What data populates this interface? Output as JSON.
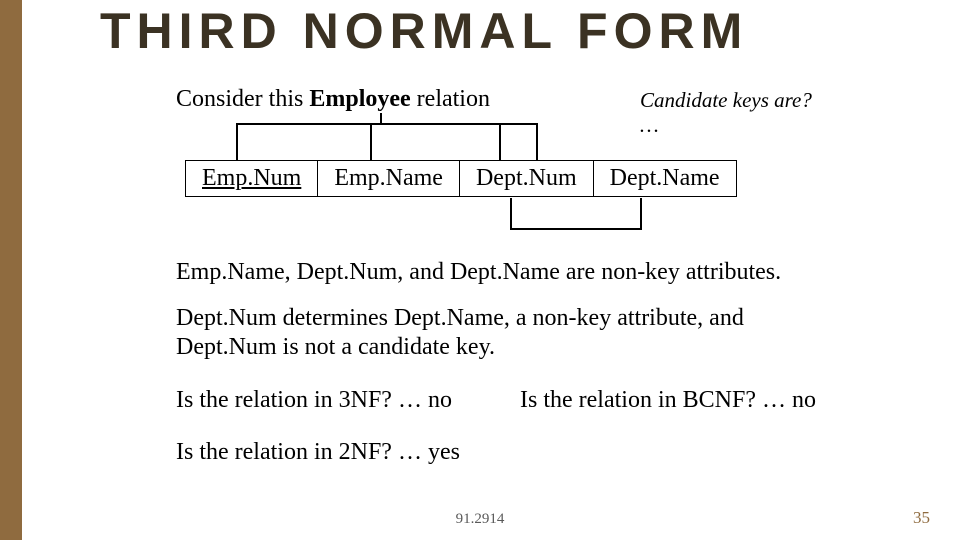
{
  "title": "THIRD NORMAL FORM",
  "intro_prefix": "Consider this ",
  "intro_bold": "Employee",
  "intro_suffix": " relation",
  "candidate_note": "Candidate keys are? …",
  "columns": [
    "Emp.Num",
    "Emp.Name",
    "Dept.Num",
    "Dept.Name"
  ],
  "para1": "Emp.Name, Dept.Num, and Dept.Name are non-key attributes.",
  "para2": "Dept.Num determines Dept.Name, a non-key attribute, and Dept.Num is not a candidate key.",
  "q_3nf": "Is the relation in 3NF? … no",
  "q_bcnf": "Is the relation in BCNF? … no",
  "q_2nf": "Is the relation in 2NF? … yes",
  "footer_center": "91.2914",
  "footer_right": "35"
}
